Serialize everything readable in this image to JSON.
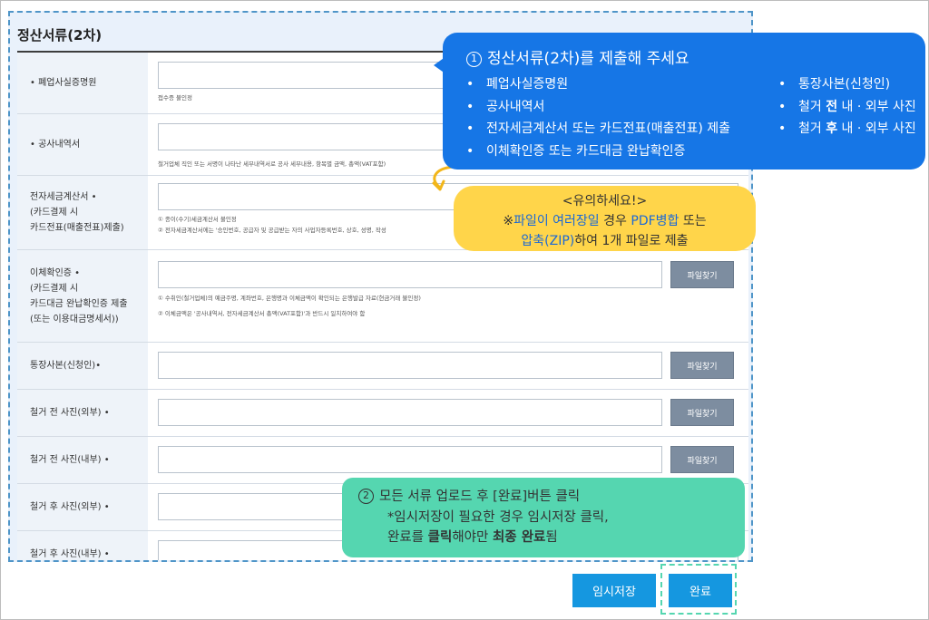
{
  "form": {
    "title": "정산서류(2차)",
    "rows": [
      {
        "label_lines": [
          "폐업사실증명원"
        ],
        "req_before": true,
        "req_after": false,
        "notes": [
          "접수증 불인정"
        ]
      },
      {
        "label_lines": [
          "공사내역서"
        ],
        "req_before": true,
        "req_after": false,
        "notes": [
          "철거업체 직인 또는 서명이 나타난 세부내역서로 공사 세부내용, 항목별 금액, 총액(VAT포함)"
        ]
      },
      {
        "label_lines": [
          "전자세금계산서 •",
          "(카드결제 시",
          "카드전표(매출전표)제출)"
        ],
        "req_before": false,
        "req_after": false,
        "notes": [
          "① 종이(수기)세금계산서 불인정",
          "② 전자세금계산서에는 '승인번호, 공급자 및 공급받는 자의 사업자등록번호, 상호, 성명, 작성"
        ]
      },
      {
        "label_lines": [
          "이체확인증 •",
          "(카드결제 시",
          "카드대금 완납확인증 제출",
          "(또는 이용대금명세서))"
        ],
        "req_before": false,
        "req_after": false,
        "notes": [
          "① 수취인(철거업체)의 예금주명, 계좌번호, 은행명과 이체금액이 확인되는 은행발급 자료(현금거래 불인정)",
          "② 이체금액은 '공사내역서, 전자세금계산서 총액(VAT포함)'과 반드시 일치하여야 함"
        ]
      },
      {
        "label_lines": [
          "통장사본(신청인)•"
        ],
        "req_before": false,
        "req_after": false,
        "notes": []
      },
      {
        "label_lines": [
          "철거 전 사진(외부) •"
        ],
        "req_before": false,
        "req_after": false,
        "notes": []
      },
      {
        "label_lines": [
          "철거 전 사진(내부) •"
        ],
        "req_before": false,
        "req_after": false,
        "notes": []
      },
      {
        "label_lines": [
          "철거 후 사진(외부) •"
        ],
        "req_before": false,
        "req_after": false,
        "notes": []
      },
      {
        "label_lines": [
          "철거 후 사진(내부) •"
        ],
        "req_before": false,
        "req_after": false,
        "notes": []
      }
    ],
    "file_button_label": "파일찾기"
  },
  "callout_blue": {
    "number": "1",
    "heading": "정산서류(2차)를 제출해 주세요",
    "left_items": [
      "폐업사실증명원",
      "공사내역서",
      "전자세금계산서 또는 카드전표(매출전표) 제출",
      "이체확인증 또는 카드대금 완납확인증"
    ],
    "right_items": [
      {
        "pre": "통장사본(신청인)",
        "bold": "",
        "post": ""
      },
      {
        "pre": "철거 ",
        "bold": "전",
        "post": " 내 · 외부 사진"
      },
      {
        "pre": "철거 ",
        "bold": "후",
        "post": " 내 · 외부 사진"
      }
    ],
    "color": "#1676e6"
  },
  "callout_yellow": {
    "title": "<유의하세요!>",
    "line2_a": "※",
    "line2_b": "파일이 여러장일",
    "line2_c": " 경우 ",
    "line2_d": "PDF병합",
    "line2_e": " 또는",
    "line3_a": "압축(ZIP)",
    "line3_b": "하여 1개 파일로 제출",
    "color": "#ffd54a"
  },
  "callout_green": {
    "number": "2",
    "line1": "모든 서류 업로드 후 [완료]버튼 클릭",
    "line2": "*임시저장이 필요한 경우 임시저장 클릭,",
    "line3_a": "완료를 ",
    "line3_b": "클릭",
    "line3_c": "해야만 ",
    "line3_d": "최종 완료",
    "line3_e": "됨",
    "color": "#55d6b0"
  },
  "buttons": {
    "temp_save": "임시저장",
    "complete": "완료"
  }
}
